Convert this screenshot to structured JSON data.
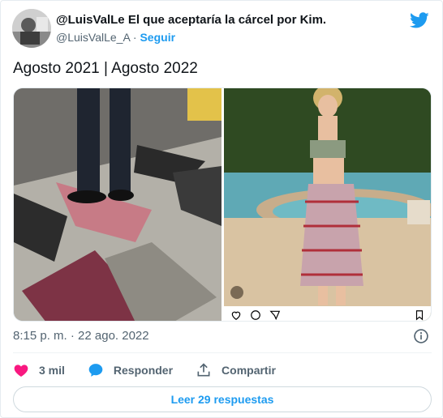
{
  "author": {
    "display_name": "@LuisValLe⁨ El que aceptaría la cárcel por Kim.",
    "handle": "@LuisValLe_A",
    "separator": "·",
    "follow_label": "Seguir"
  },
  "tweet": {
    "text": "Agosto 2021  |  Agosto 2022",
    "timestamp": "8:15 p. m. · 22 ago. 2022"
  },
  "actions": {
    "like_count": "3 mil",
    "reply_label": "Responder",
    "share_label": "Compartir"
  },
  "footer": {
    "read_replies_label": "Leer 29 respuestas"
  },
  "colors": {
    "accent": "#1d9bf0",
    "like": "#f91880",
    "muted": "#536471"
  },
  "icons": [
    "twitter-bird-icon",
    "info-icon",
    "heart-icon",
    "reply-bubble-icon",
    "share-icon",
    "ig-heart-icon",
    "ig-comment-icon",
    "ig-send-icon",
    "ig-bookmark-icon"
  ]
}
